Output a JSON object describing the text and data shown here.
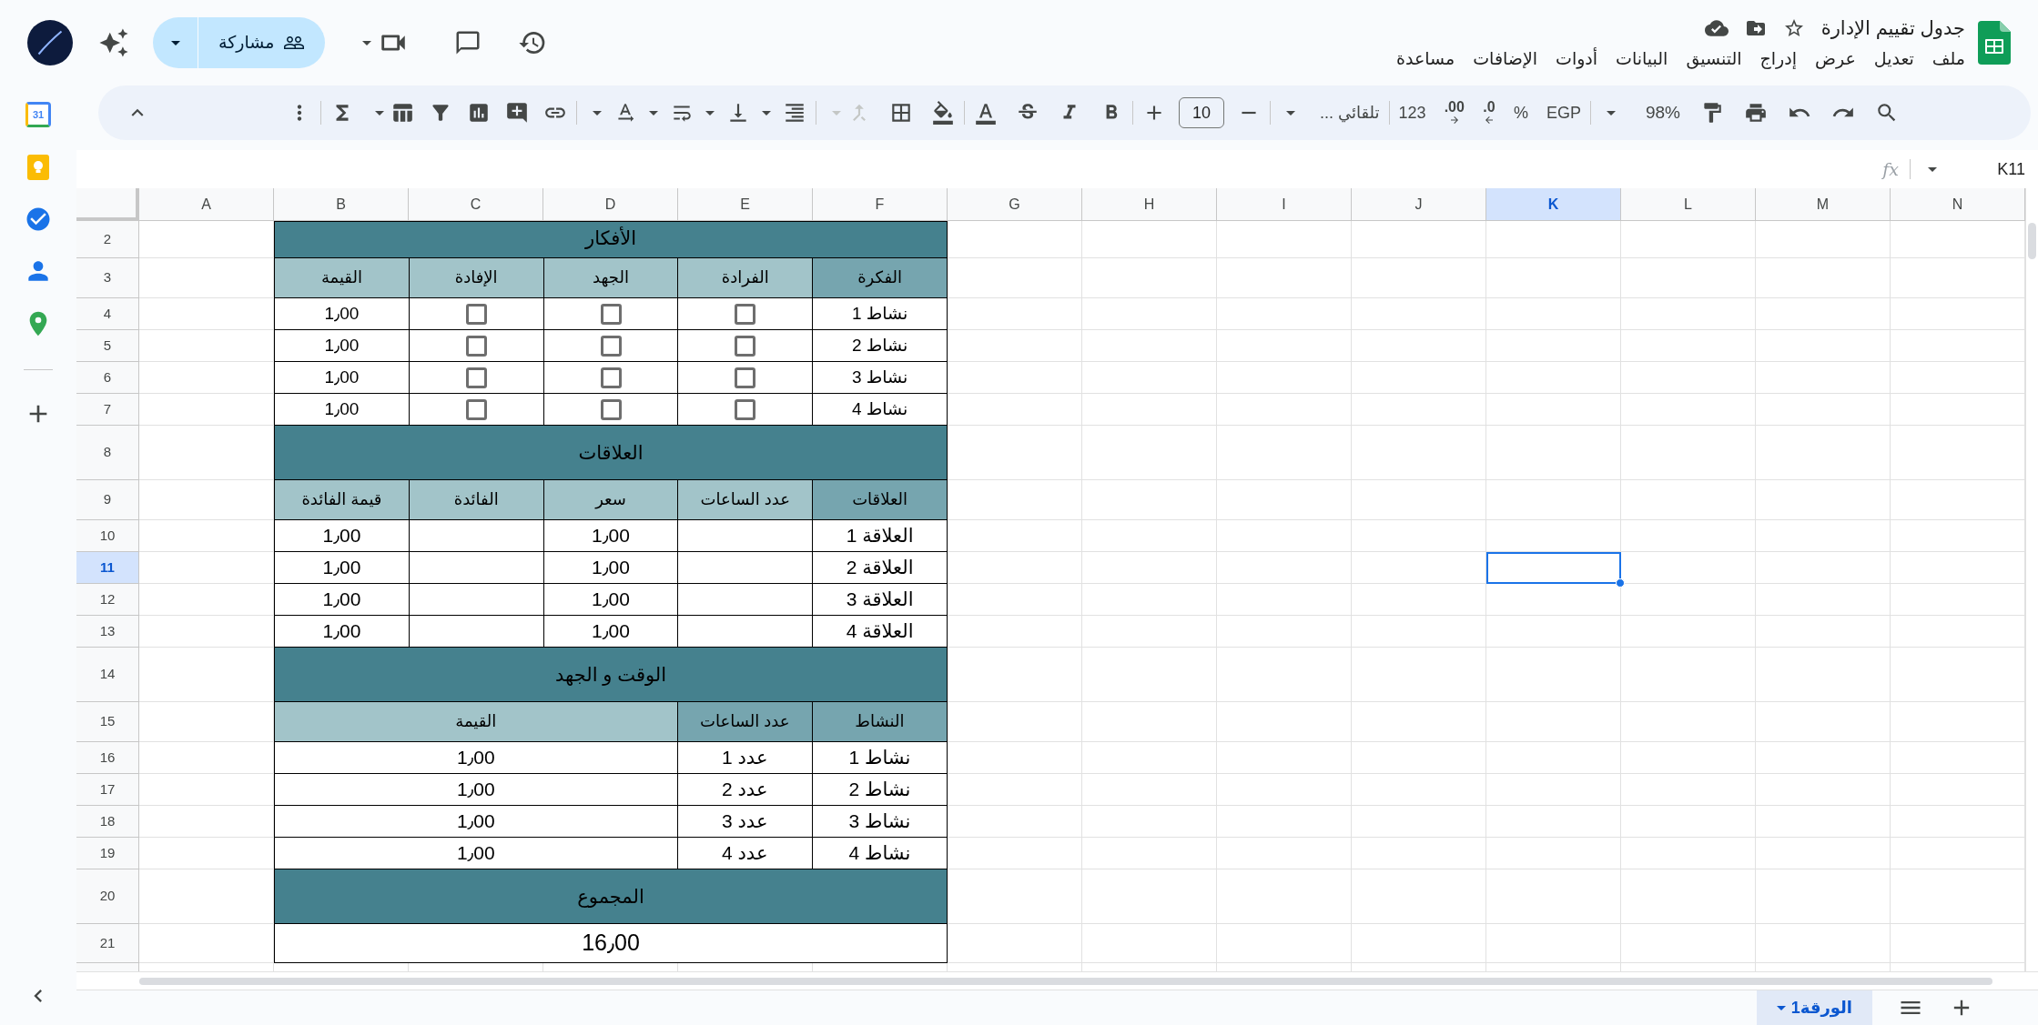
{
  "document": {
    "title": "جدول تقييم الإدارة",
    "menu": [
      "ملف",
      "تعديل",
      "عرض",
      "إدراج",
      "التنسيق",
      "البيانات",
      "أدوات",
      "الإضافات",
      "مساعدة"
    ],
    "share_label": "مشاركة"
  },
  "toolbar": {
    "zoom": "98%",
    "currency": "EGP",
    "percent": "%",
    "decrease_decimal": ".0",
    "increase_decimal": ".00",
    "number_format": "123",
    "font": "تلقائي ...",
    "font_size": "10"
  },
  "sidebar": {
    "calendar_day": "31"
  },
  "formula_bar": {
    "fx": "fx",
    "cell": "K11"
  },
  "columns": [
    {
      "label": "N",
      "selected": false
    },
    {
      "label": "M",
      "selected": false
    },
    {
      "label": "L",
      "selected": false
    },
    {
      "label": "K",
      "selected": true
    },
    {
      "label": "J",
      "selected": false
    },
    {
      "label": "I",
      "selected": false
    },
    {
      "label": "H",
      "selected": false
    },
    {
      "label": "G",
      "selected": false
    },
    {
      "label": "F",
      "selected": false
    },
    {
      "label": "E",
      "selected": false
    },
    {
      "label": "D",
      "selected": false
    },
    {
      "label": "C",
      "selected": false
    },
    {
      "label": "B",
      "selected": false
    },
    {
      "label": "A",
      "selected": false
    }
  ],
  "rows": [
    {
      "label": "2",
      "selected": false,
      "kind": "title",
      "text": "الأفكار"
    },
    {
      "label": "3",
      "selected": false,
      "kind": "header",
      "cells": [
        {
          "kind": "text",
          "text": "الفكرة",
          "color": "#76a5af"
        },
        {
          "kind": "text",
          "text": "الفرادة",
          "color": "#a2c4c9"
        },
        {
          "kind": "text",
          "text": "الجهد",
          "color": "#a2c4c9"
        },
        {
          "kind": "text",
          "text": "الإفادة",
          "color": "#a2c4c9"
        },
        {
          "kind": "text",
          "text": "القيمة",
          "color": "#a2c4c9"
        }
      ]
    },
    {
      "label": "4",
      "selected": false,
      "kind": "data",
      "cells": [
        {
          "kind": "text",
          "text": "نشاط 1"
        },
        {
          "kind": "checkbox",
          "checked": false
        },
        {
          "kind": "checkbox",
          "checked": false
        },
        {
          "kind": "checkbox",
          "checked": false
        },
        {
          "kind": "text",
          "text": "1٫00"
        }
      ]
    },
    {
      "label": "5",
      "selected": false,
      "kind": "data",
      "cells": [
        {
          "kind": "text",
          "text": "نشاط 2"
        },
        {
          "kind": "checkbox",
          "checked": false
        },
        {
          "kind": "checkbox",
          "checked": false
        },
        {
          "kind": "checkbox",
          "checked": false
        },
        {
          "kind": "text",
          "text": "1٫00"
        }
      ]
    },
    {
      "label": "6",
      "selected": false,
      "kind": "data",
      "cells": [
        {
          "kind": "text",
          "text": "نشاط 3"
        },
        {
          "kind": "checkbox",
          "checked": false
        },
        {
          "kind": "checkbox",
          "checked": false
        },
        {
          "kind": "checkbox",
          "checked": false
        },
        {
          "kind": "text",
          "text": "1٫00"
        }
      ]
    },
    {
      "label": "7",
      "selected": false,
      "kind": "data",
      "cells": [
        {
          "kind": "text",
          "text": "نشاط 4"
        },
        {
          "kind": "checkbox",
          "checked": false
        },
        {
          "kind": "checkbox",
          "checked": false
        },
        {
          "kind": "checkbox",
          "checked": false
        },
        {
          "kind": "text",
          "text": "1٫00"
        }
      ]
    },
    {
      "label": "8",
      "selected": false,
      "kind": "title",
      "text": "العلاقات"
    },
    {
      "label": "9",
      "selected": false,
      "kind": "header",
      "cells": [
        {
          "kind": "text",
          "text": "العلاقات",
          "color": "#76a5af"
        },
        {
          "kind": "text",
          "text": "عدد الساعات",
          "color": "#a2c4c9"
        },
        {
          "kind": "text",
          "text": "سعر",
          "color": "#a2c4c9"
        },
        {
          "kind": "text",
          "text": "الفائدة",
          "color": "#a2c4c9"
        },
        {
          "kind": "text",
          "text": "قيمة الفائدة",
          "color": "#a2c4c9"
        }
      ]
    },
    {
      "label": "10",
      "selected": false,
      "kind": "data",
      "cells": [
        {
          "kind": "text",
          "text": "العلاقة 1"
        },
        {
          "kind": "blank"
        },
        {
          "kind": "text",
          "text": "1٫00"
        },
        {
          "kind": "blank"
        },
        {
          "kind": "text",
          "text": "1٫00"
        }
      ]
    },
    {
      "label": "11",
      "selected": true,
      "kind": "data",
      "cells": [
        {
          "kind": "text",
          "text": "العلاقة 2"
        },
        {
          "kind": "blank"
        },
        {
          "kind": "text",
          "text": "1٫00"
        },
        {
          "kind": "blank"
        },
        {
          "kind": "text",
          "text": "1٫00"
        }
      ]
    },
    {
      "label": "12",
      "selected": false,
      "kind": "data",
      "cells": [
        {
          "kind": "text",
          "text": "العلاقة 3"
        },
        {
          "kind": "blank"
        },
        {
          "kind": "text",
          "text": "1٫00"
        },
        {
          "kind": "blank"
        },
        {
          "kind": "text",
          "text": "1٫00"
        }
      ]
    },
    {
      "label": "13",
      "selected": false,
      "kind": "data",
      "cells": [
        {
          "kind": "text",
          "text": "العلاقة 4"
        },
        {
          "kind": "blank"
        },
        {
          "kind": "text",
          "text": "1٫00"
        },
        {
          "kind": "blank"
        },
        {
          "kind": "text",
          "text": "1٫00"
        }
      ]
    },
    {
      "label": "14",
      "selected": false,
      "kind": "title",
      "text": "الوقت و الجهد"
    },
    {
      "label": "15",
      "selected": false,
      "kind": "header",
      "cells": [
        {
          "kind": "text",
          "text": "النشاط",
          "color": "#76a5af"
        },
        {
          "kind": "text",
          "text": "عدد الساعات",
          "color": "#76a5af"
        },
        {
          "kind": "wide",
          "text": "القيمة",
          "color": "#a2c4c9"
        }
      ]
    },
    {
      "label": "16",
      "selected": false,
      "kind": "data",
      "cells": [
        {
          "kind": "text",
          "text": "نشاط 1"
        },
        {
          "kind": "text",
          "text": "عدد 1"
        },
        {
          "kind": "wide",
          "text": "1٫00"
        }
      ]
    },
    {
      "label": "17",
      "selected": false,
      "kind": "data",
      "cells": [
        {
          "kind": "text",
          "text": "نشاط 2"
        },
        {
          "kind": "text",
          "text": "عدد 2"
        },
        {
          "kind": "wide",
          "text": "1٫00"
        }
      ]
    },
    {
      "label": "18",
      "selected": false,
      "kind": "data",
      "cells": [
        {
          "kind": "text",
          "text": "نشاط 3"
        },
        {
          "kind": "text",
          "text": "عدد 3"
        },
        {
          "kind": "wide",
          "text": "1٫00"
        }
      ]
    },
    {
      "label": "19",
      "selected": false,
      "kind": "data",
      "cells": [
        {
          "kind": "text",
          "text": "نشاط 4"
        },
        {
          "kind": "text",
          "text": "عدد 4"
        },
        {
          "kind": "wide",
          "text": "1٫00"
        }
      ]
    },
    {
      "label": "20",
      "selected": false,
      "kind": "title",
      "text": "المجموع"
    },
    {
      "label": "21",
      "selected": false,
      "kind": "total",
      "text": "16٫00"
    }
  ],
  "sheet_tabs": [
    {
      "label": "الورقة1",
      "selected": true
    }
  ]
}
